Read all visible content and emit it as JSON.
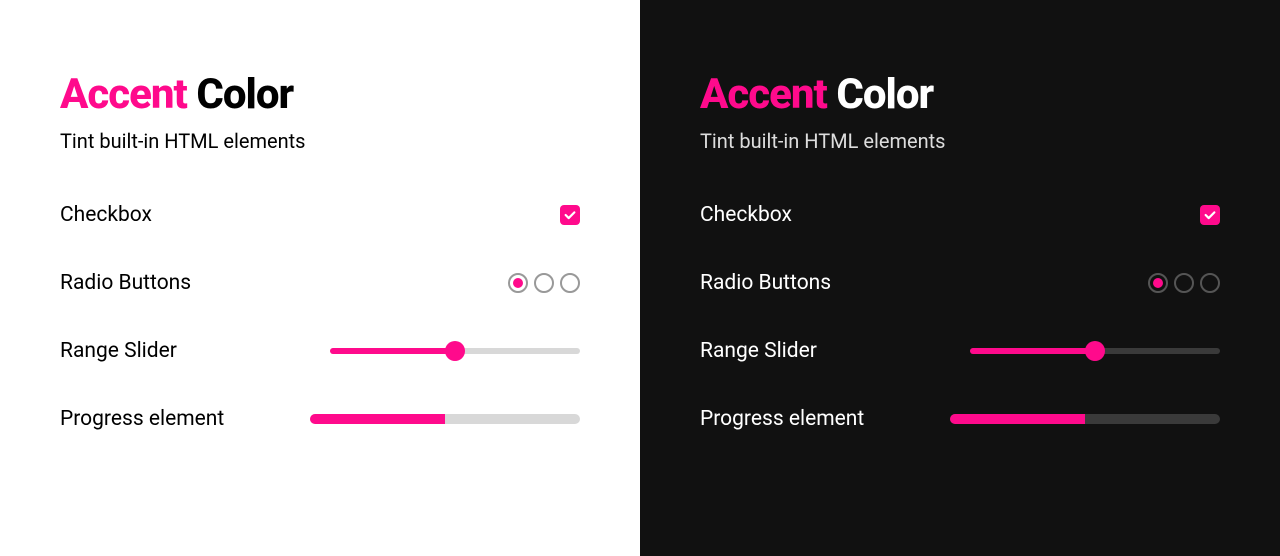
{
  "accent_color": "#ff0a8c",
  "title": {
    "accent_word": "Accent",
    "rest": "Color"
  },
  "subtitle": "Tint built-in HTML elements",
  "rows": {
    "checkbox": {
      "label": "Checkbox",
      "checked": true
    },
    "radio": {
      "label": "Radio Buttons",
      "options": [
        true,
        false,
        false
      ]
    },
    "range": {
      "label": "Range Slider",
      "value": 50,
      "min": 0,
      "max": 100
    },
    "progress": {
      "label": "Progress element",
      "value": 50,
      "max": 100
    }
  }
}
